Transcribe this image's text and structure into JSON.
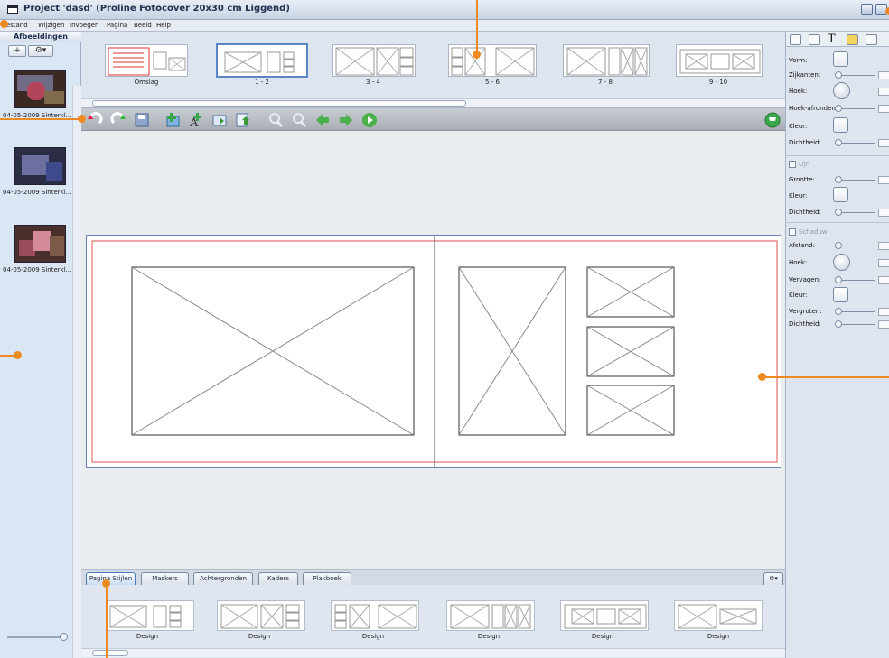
{
  "window": {
    "title": "Project 'dasd' (Proline Fotocover 20x30 cm Liggend)"
  },
  "menu": [
    "Bestand",
    "Wijzigen",
    "Invoegen",
    "Pagina",
    "Beeld",
    "Help"
  ],
  "left_panel": {
    "title": "Afbeeldingen",
    "add_label": "+",
    "gear_icon": "gear-icon",
    "images": [
      {
        "label": "04-05-2009 Sinterkl..."
      },
      {
        "label": "04-05-2009 Sinterkl..."
      },
      {
        "label": "04-05-2009 Sinterkl..."
      }
    ]
  },
  "pages": [
    {
      "label": "Omslag"
    },
    {
      "label": "1 - 2"
    },
    {
      "label": "3 - 4"
    },
    {
      "label": "5 - 6"
    },
    {
      "label": "7 - 8"
    },
    {
      "label": "9 - 10"
    }
  ],
  "toolbar_icons": [
    "undo-icon",
    "redo-icon",
    "save-icon",
    "add-photo-icon",
    "add-text-icon",
    "page-icon",
    "export-icon",
    "zoom-out-icon",
    "zoom-in-icon",
    "arrow-left-icon",
    "arrow-right-icon",
    "play-icon",
    "cart-icon"
  ],
  "bottom_tabs": [
    "Pagina Stijlen",
    "Maskers",
    "Achtergronden",
    "Kaders",
    "Plakboek"
  ],
  "designs": [
    {
      "label": "Design"
    },
    {
      "label": "Design"
    },
    {
      "label": "Design"
    },
    {
      "label": "Design"
    },
    {
      "label": "Design"
    },
    {
      "label": "Design"
    }
  ],
  "right_panel": {
    "vorm": "Vorm:",
    "zijkanten": "Zijkanten:",
    "hoek": "Hoek:",
    "hoek_afronden": "Hoek-afronden:",
    "kleur": "Kleur:",
    "dichtheid": "Dichtheid:",
    "lijn_label": "Lijn",
    "grootte": "Grootte:",
    "schaduw_label": "Schaduw",
    "afstand": "Afstand:",
    "vervagen": "Vervagen:",
    "vergroten": "Vergroten:"
  }
}
